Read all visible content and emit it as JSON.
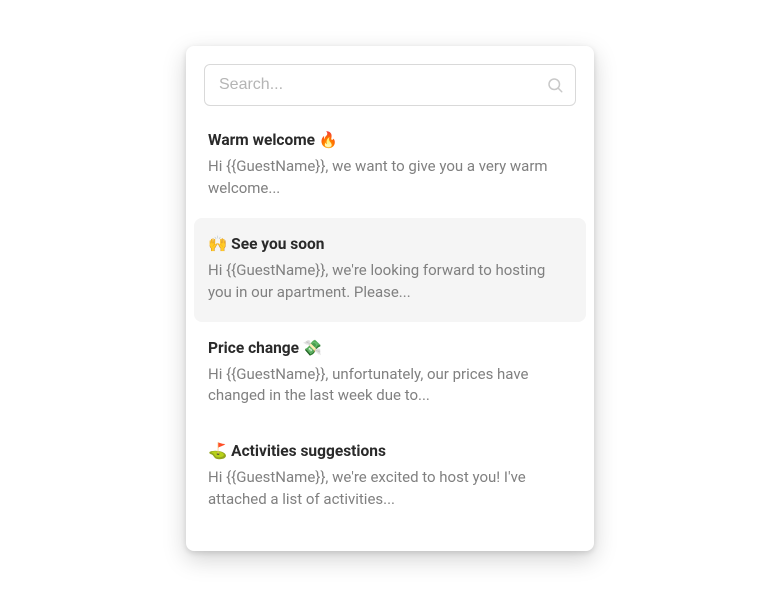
{
  "search": {
    "placeholder": "Search..."
  },
  "templates": [
    {
      "title": "Warm welcome 🔥",
      "preview": "Hi {{GuestName}}, we want to give you a very warm welcome...",
      "selected": false
    },
    {
      "title": "🙌 See you soon",
      "preview": "Hi {{GuestName}}, we're looking forward to hosting you in our apartment. Please...",
      "selected": true
    },
    {
      "title": "Price change 💸",
      "preview": "Hi {{GuestName}}, unfortunately, our prices have changed in the last week due to...",
      "selected": false
    },
    {
      "title": "⛳ Activities suggestions",
      "preview": "Hi {{GuestName}}, we're excited to host you! I've attached a list of activities...",
      "selected": false
    }
  ]
}
